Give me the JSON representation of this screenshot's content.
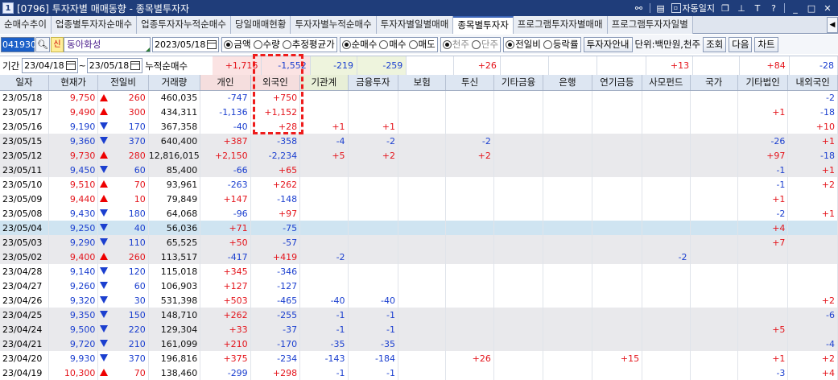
{
  "window": {
    "code": "1",
    "title": "[0796] 투자자별 매매동향 - 종목별투자자",
    "auto_close_label": "자동일지",
    "icons": [
      "link-icon",
      "menu-icon",
      "help-icon",
      "minimize-icon",
      "restore-icon",
      "close-icon"
    ]
  },
  "tabs": [
    {
      "label": "순매수추이",
      "active": false
    },
    {
      "label": "업종별투자자순매수",
      "active": false
    },
    {
      "label": "업종투자자누적순매수",
      "active": false
    },
    {
      "label": "당일매매현황",
      "active": false
    },
    {
      "label": "투자자별누적순매수",
      "active": false
    },
    {
      "label": "투자자별일별매매",
      "active": false
    },
    {
      "label": "종목별투자자",
      "active": true
    },
    {
      "label": "프로그램투자자별매매",
      "active": false
    },
    {
      "label": "프로그램투자자일별",
      "active": false
    }
  ],
  "controls": {
    "code": "041930",
    "sin_label": "신",
    "stock_name": "동아화성",
    "date": "2023/05/18",
    "value_type": [
      {
        "label": "금액",
        "on": true
      },
      {
        "label": "수량",
        "on": false
      },
      {
        "label": "추정평균가",
        "on": false
      }
    ],
    "trade_type": [
      {
        "label": "순매수",
        "on": true
      },
      {
        "label": "매수",
        "on": false
      },
      {
        "label": "매도",
        "on": false
      }
    ],
    "unit_type": [
      {
        "label": "천주",
        "on": true
      },
      {
        "label": "단주",
        "on": false
      }
    ],
    "compare_type": [
      {
        "label": "전일비",
        "on": true
      },
      {
        "label": "등락률",
        "on": false
      }
    ],
    "investor_guide_button": "투자자안내",
    "unit_text": "단위:백만원,천주",
    "query_button": "조회",
    "next_button": "다음",
    "chart_button": "차트"
  },
  "period": {
    "label": "기간",
    "from": "23/04/18",
    "to": "23/05/18",
    "cum_label": "누적순매수",
    "sums": [
      "+1,716",
      "-1,552",
      "-219",
      "-259",
      "",
      "+26",
      "",
      "",
      "",
      "+13",
      "",
      "+84",
      "-28"
    ]
  },
  "columns": [
    "일자",
    "현재가",
    "전일비",
    "거래량",
    "개인",
    "외국인",
    "기관계",
    "금융투자",
    "보험",
    "투신",
    "기타금융",
    "은행",
    "연기금등",
    "사모펀드",
    "국가",
    "기타법인",
    "내외국인"
  ],
  "rows": [
    {
      "date": "23/05/18",
      "price": "9,750",
      "dir": "up",
      "chg": "260",
      "vol": "460,035",
      "v": [
        "-747",
        "+750",
        "",
        "",
        "",
        "",
        "",
        "",
        "",
        "",
        "",
        "",
        "-2"
      ],
      "style": ""
    },
    {
      "date": "23/05/17",
      "price": "9,490",
      "dir": "up",
      "chg": "300",
      "vol": "434,311",
      "v": [
        "-1,136",
        "+1,152",
        "",
        "",
        "",
        "",
        "",
        "",
        "",
        "",
        "",
        "+1",
        "-18"
      ],
      "style": ""
    },
    {
      "date": "23/05/16",
      "price": "9,190",
      "dir": "down",
      "chg": "170",
      "vol": "367,358",
      "v": [
        "-40",
        "+28",
        "+1",
        "+1",
        "",
        "",
        "",
        "",
        "",
        "",
        "",
        "",
        "+10"
      ],
      "style": ""
    },
    {
      "date": "23/05/15",
      "price": "9,360",
      "dir": "down",
      "chg": "370",
      "vol": "640,400",
      "v": [
        "+387",
        "-358",
        "-4",
        "-2",
        "",
        "-2",
        "",
        "",
        "",
        "",
        "",
        "-26",
        "+1"
      ],
      "style": "shade"
    },
    {
      "date": "23/05/12",
      "price": "9,730",
      "dir": "up",
      "chg": "280",
      "vol": "12,816,015",
      "v": [
        "+2,150",
        "-2,234",
        "+5",
        "+2",
        "",
        "+2",
        "",
        "",
        "",
        "",
        "",
        "+97",
        "-18"
      ],
      "style": "shade"
    },
    {
      "date": "23/05/11",
      "price": "9,450",
      "dir": "down",
      "chg": "60",
      "vol": "85,400",
      "v": [
        "-66",
        "+65",
        "",
        "",
        "",
        "",
        "",
        "",
        "",
        "",
        "",
        "-1",
        "+1"
      ],
      "style": "shade"
    },
    {
      "date": "23/05/10",
      "price": "9,510",
      "dir": "up",
      "chg": "70",
      "vol": "93,961",
      "v": [
        "-263",
        "+262",
        "",
        "",
        "",
        "",
        "",
        "",
        "",
        "",
        "",
        "-1",
        "+2"
      ],
      "style": ""
    },
    {
      "date": "23/05/09",
      "price": "9,440",
      "dir": "up",
      "chg": "10",
      "vol": "79,849",
      "v": [
        "+147",
        "-148",
        "",
        "",
        "",
        "",
        "",
        "",
        "",
        "",
        "",
        "+1",
        ""
      ],
      "style": ""
    },
    {
      "date": "23/05/08",
      "price": "9,430",
      "dir": "down",
      "chg": "180",
      "vol": "64,068",
      "v": [
        "-96",
        "+97",
        "",
        "",
        "",
        "",
        "",
        "",
        "",
        "",
        "",
        "-2",
        "+1"
      ],
      "style": ""
    },
    {
      "date": "23/05/04",
      "price": "9,250",
      "dir": "down",
      "chg": "40",
      "vol": "56,036",
      "v": [
        "+71",
        "-75",
        "",
        "",
        "",
        "",
        "",
        "",
        "",
        "",
        "",
        "+4",
        ""
      ],
      "style": "hl"
    },
    {
      "date": "23/05/03",
      "price": "9,290",
      "dir": "down",
      "chg": "110",
      "vol": "65,525",
      "v": [
        "+50",
        "-57",
        "",
        "",
        "",
        "",
        "",
        "",
        "",
        "",
        "",
        "+7",
        ""
      ],
      "style": "shade"
    },
    {
      "date": "23/05/02",
      "price": "9,400",
      "dir": "up",
      "chg": "260",
      "vol": "113,517",
      "v": [
        "-417",
        "+419",
        "-2",
        "",
        "",
        "",
        "",
        "",
        "",
        "-2",
        "",
        "",
        ""
      ],
      "style": "shade"
    },
    {
      "date": "23/04/28",
      "price": "9,140",
      "dir": "down",
      "chg": "120",
      "vol": "115,018",
      "v": [
        "+345",
        "-346",
        "",
        "",
        "",
        "",
        "",
        "",
        "",
        "",
        "",
        "",
        ""
      ],
      "style": ""
    },
    {
      "date": "23/04/27",
      "price": "9,260",
      "dir": "down",
      "chg": "60",
      "vol": "106,903",
      "v": [
        "+127",
        "-127",
        "",
        "",
        "",
        "",
        "",
        "",
        "",
        "",
        "",
        "",
        ""
      ],
      "style": ""
    },
    {
      "date": "23/04/26",
      "price": "9,320",
      "dir": "down",
      "chg": "30",
      "vol": "531,398",
      "v": [
        "+503",
        "-465",
        "-40",
        "-40",
        "",
        "",
        "",
        "",
        "",
        "",
        "",
        "",
        "+2"
      ],
      "style": ""
    },
    {
      "date": "23/04/25",
      "price": "9,350",
      "dir": "down",
      "chg": "150",
      "vol": "148,710",
      "v": [
        "+262",
        "-255",
        "-1",
        "-1",
        "",
        "",
        "",
        "",
        "",
        "",
        "",
        "",
        "-6"
      ],
      "style": "shade"
    },
    {
      "date": "23/04/24",
      "price": "9,500",
      "dir": "down",
      "chg": "220",
      "vol": "129,304",
      "v": [
        "+33",
        "-37",
        "-1",
        "-1",
        "",
        "",
        "",
        "",
        "",
        "",
        "",
        "+5",
        ""
      ],
      "style": "shade"
    },
    {
      "date": "23/04/21",
      "price": "9,720",
      "dir": "down",
      "chg": "210",
      "vol": "161,099",
      "v": [
        "+210",
        "-170",
        "-35",
        "-35",
        "",
        "",
        "",
        "",
        "",
        "",
        "",
        "",
        "-4"
      ],
      "style": "shade"
    },
    {
      "date": "23/04/20",
      "price": "9,930",
      "dir": "down",
      "chg": "370",
      "vol": "196,816",
      "v": [
        "+375",
        "-234",
        "-143",
        "-184",
        "",
        "+26",
        "",
        "",
        "+15",
        "",
        "",
        "+1",
        "+2"
      ],
      "style": ""
    },
    {
      "date": "23/04/19",
      "price": "10,300",
      "dir": "up",
      "chg": "70",
      "vol": "138,460",
      "v": [
        "-299",
        "+298",
        "-1",
        "-1",
        "",
        "",
        "",
        "",
        "",
        "",
        "",
        "-3",
        "+4"
      ],
      "style": ""
    }
  ],
  "colors": {
    "up": "#e4141b",
    "down": "#1b3fcf",
    "title_bar": "#1f3d7a",
    "highlight_box": "#ee1c1c"
  }
}
